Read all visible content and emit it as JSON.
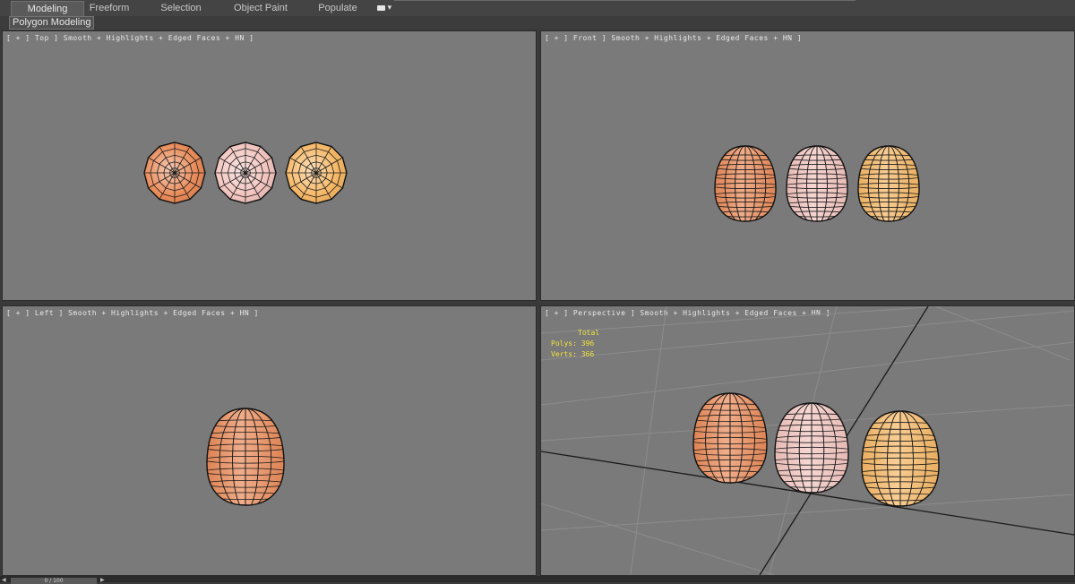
{
  "ribbon": {
    "tabs": [
      {
        "label": "Modeling",
        "active": true
      },
      {
        "label": "Freeform",
        "active": false
      },
      {
        "label": "Selection",
        "active": false
      },
      {
        "label": "Object Paint",
        "active": false
      },
      {
        "label": "Populate",
        "active": false
      }
    ],
    "menu_icon": "options-dropdown-icon",
    "sub_button": "Polygon Modeling"
  },
  "viewports": {
    "top": {
      "label": "[ + ] Top ] Smooth + Highlights + Edged Faces + HN ]"
    },
    "front": {
      "label": "[ + ] Front ] Smooth + Highlights + Edged Faces + HN ]"
    },
    "left": {
      "label": "[ + ] Left ] Smooth + Highlights + Edged Faces + HN ]"
    },
    "perspective": {
      "label": "[ + ] Perspective ] Smooth + Highlights + Edged Faces + HN ]",
      "stats": {
        "header": "Total",
        "polys": "Polys: 396",
        "verts": "Verts: 366"
      }
    }
  },
  "objects": [
    {
      "name": "egg-orange",
      "color": "#e98a58"
    },
    {
      "name": "egg-pink",
      "color": "#f2c4be"
    },
    {
      "name": "egg-yellow",
      "color": "#f5b765"
    }
  ],
  "timeline": {
    "frame": "0 / 100"
  },
  "colors": {
    "stats_text": "#f2e23a",
    "viewport_bg": "#7a7a7a"
  }
}
